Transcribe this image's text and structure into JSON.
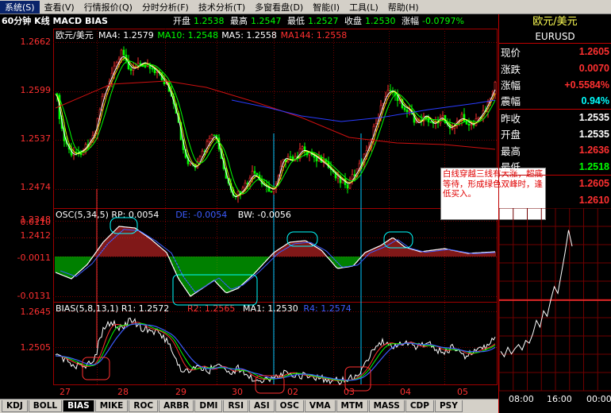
{
  "menu": [
    "系统(S)",
    "查看(V)",
    "行情报价(Q)",
    "分时分析(F)",
    "技术分析(T)",
    "多窗看盘(D)",
    "智能(I)",
    "工具(L)",
    "帮助(H)"
  ],
  "top_header": {
    "title": "60分钟 K线 MACD BIAS",
    "items": [
      {
        "label": "开盘",
        "value": "1.2538"
      },
      {
        "label": "最高",
        "value": "1.2547"
      },
      {
        "label": "最低",
        "value": "1.2527"
      },
      {
        "label": "收盘",
        "value": "1.2530"
      },
      {
        "label": "涨幅",
        "value": "-0.0797%"
      }
    ]
  },
  "price_panel": {
    "legend_name": "欧元/美元",
    "ma": [
      {
        "label": "MA4: 1.2579",
        "color": "#ffffff"
      },
      {
        "label": "MA10: 1.2548",
        "color": "#00ff00"
      },
      {
        "label": "MA5: 1.2558",
        "color": "#ffffff"
      },
      {
        "label": "MA144: 1.2558",
        "color": "#ff3030"
      }
    ],
    "y_ticks": [
      "1.2662",
      "1.2599",
      "1.2537",
      "1.2474",
      "1.2412",
      "1.2348"
    ]
  },
  "osc_panel": {
    "legend": [
      {
        "label": "OSC(5,34,5) RP: 0.0054",
        "color": "#ffffff"
      },
      {
        "label": "DE: -0.0054",
        "color": "#3c5cff"
      },
      {
        "label": "BW: -0.0056",
        "color": "#ffffff"
      }
    ],
    "y_ticks": [
      "0.0110",
      "-0.0011",
      "-0.0131"
    ]
  },
  "bias_panel": {
    "legend": [
      {
        "label": "BIAS(5,8,13,1) R1: 1.2572",
        "color": "#ffffff"
      },
      {
        "label": "R2: 1.2565",
        "color": "#ff3030"
      },
      {
        "label": "MA1: 1.2530",
        "color": "#ffffff"
      },
      {
        "label": "R4: 1.2574",
        "color": "#3c5cff"
      }
    ],
    "y_ticks": [
      "1.2645",
      "1.2505"
    ]
  },
  "x_axis": [
    "27",
    "28",
    "29",
    "30",
    "02",
    "03",
    "04",
    "05"
  ],
  "annotation": "白线穿越三线有大涨，超底等待，形成绿色双峰时，逢低买入。",
  "tabs": [
    "KDJ",
    "BOLL",
    "BIAS",
    "MIKE",
    "ROC",
    "ARBR",
    "DMI",
    "RSI",
    "ASI",
    "OSC",
    "VMA",
    "MTM",
    "MASS",
    "CDP",
    "PSY"
  ],
  "active_tab": "BIAS",
  "quote": {
    "title": "欧元/美元",
    "code": "EURUSD",
    "rows": [
      {
        "label": "现价",
        "value": "1.2605",
        "color": "#ff3030"
      },
      {
        "label": "涨跌",
        "value": "0.0070",
        "color": "#ff3030"
      },
      {
        "label": "涨幅",
        "value": "+0.5584%",
        "color": "#ff3030"
      },
      {
        "label": "震幅",
        "value": "0.94%",
        "color": "#00ffff"
      },
      {
        "label": "昨收",
        "value": "1.2535",
        "color": "#ffffff"
      },
      {
        "label": "开盘",
        "value": "1.2535",
        "color": "#ffffff"
      },
      {
        "label": "最高",
        "value": "1.2636",
        "color": "#ff3030"
      },
      {
        "label": "最低",
        "value": "1.2518",
        "color": "#00ff00"
      },
      {
        "label": "",
        "value": "1.2605",
        "color": "#ff3030"
      },
      {
        "label": "",
        "value": "1.2610",
        "color": "#ff3030"
      }
    ]
  },
  "mini_chart": {
    "x_labels": [
      "08:00",
      "16:00",
      "00:00"
    ],
    "values": [
      1.2532,
      1.2528,
      1.2535,
      1.253,
      1.2534,
      1.2537,
      1.2533,
      1.254,
      1.2538,
      1.2545,
      1.2555,
      1.255,
      1.2562,
      1.2558,
      1.257,
      1.258,
      1.2575,
      1.259,
      1.2605,
      1.2622,
      1.261
    ]
  },
  "colors": {
    "up": "#ff3030",
    "down": "#00ff00",
    "grid": "#a00000",
    "blue": "#3c5cff",
    "cyan": "#00ffff"
  }
}
